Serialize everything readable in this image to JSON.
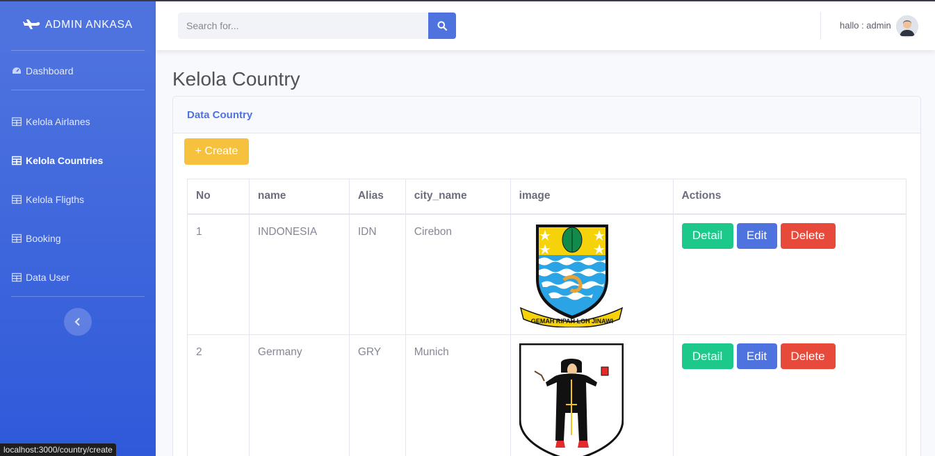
{
  "sidebar": {
    "brand": "ADMIN ANKASA",
    "items": [
      {
        "label": "Dashboard",
        "icon": "tachometer-icon",
        "active": false
      },
      {
        "label": "Kelola Airlanes",
        "icon": "table-icon",
        "active": false
      },
      {
        "label": "Kelola Countries",
        "icon": "table-icon",
        "active": true
      },
      {
        "label": "Kelola Fligths",
        "icon": "table-icon",
        "active": false
      },
      {
        "label": "Booking",
        "icon": "table-icon",
        "active": false
      },
      {
        "label": "Data User",
        "icon": "table-icon",
        "active": false
      }
    ]
  },
  "topbar": {
    "search_placeholder": "Search for...",
    "user_label": "hallo : admin"
  },
  "main": {
    "page_title": "Kelola Country",
    "card_title": "Data Country",
    "create_label": "+ Create",
    "table": {
      "headers": [
        "No",
        "name",
        "Alias",
        "city_name",
        "image",
        "Actions"
      ],
      "rows": [
        {
          "no": "1",
          "name": "INDONESIA",
          "alias": "IDN",
          "city": "Cirebon",
          "image": "cirebon-coat-of-arms",
          "motto": "GEMAH RIPAH LOH JINAWI"
        },
        {
          "no": "2",
          "name": "Germany",
          "alias": "GRY",
          "city": "Munich",
          "image": "munich-coat-of-arms"
        }
      ],
      "actions": {
        "detail": "Detail",
        "edit": "Edit",
        "delete": "Delete"
      }
    }
  },
  "status_bar": {
    "url": "localhost:3000/country/create"
  },
  "colors": {
    "primary": "#4e73df",
    "success": "#1cc88a",
    "danger": "#e74a3b",
    "warning": "#f6c23e"
  }
}
